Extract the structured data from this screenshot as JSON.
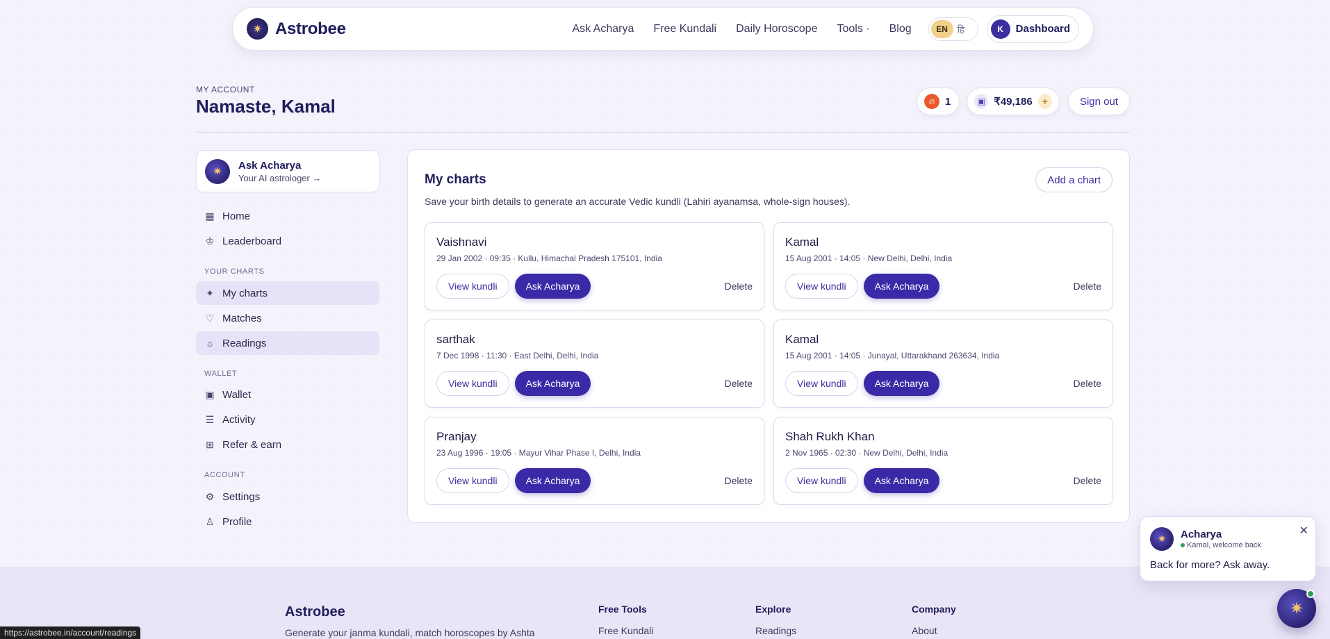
{
  "nav": {
    "brand": "Astrobee",
    "links": [
      "Ask Acharya",
      "Free Kundali",
      "Daily Horoscope",
      "Tools ·",
      "Blog"
    ],
    "lang_en": "EN",
    "lang_hi": "हि",
    "dashboard_initial": "K",
    "dashboard_label": "Dashboard"
  },
  "header": {
    "eyebrow": "MY ACCOUNT",
    "greeting": "Namaste, Kamal",
    "streak": "1",
    "wallet_balance": "₹49,186",
    "sign_out": "Sign out"
  },
  "sidebar": {
    "ask_title": "Ask Acharya",
    "ask_sub": "Your AI astrologer →",
    "home": "Home",
    "leaderboard": "Leaderboard",
    "section_charts": "YOUR CHARTS",
    "my_charts": "My charts",
    "matches": "Matches",
    "readings": "Readings",
    "section_wallet": "WALLET",
    "wallet": "Wallet",
    "activity": "Activity",
    "refer": "Refer & earn",
    "section_account": "ACCOUNT",
    "settings": "Settings",
    "profile": "Profile"
  },
  "main": {
    "title": "My charts",
    "description": "Save your birth details to generate an accurate Vedic kundli (Lahiri ayanamsa, whole-sign houses).",
    "add_label": "Add a chart",
    "view_label": "View kundli",
    "ask_label": "Ask Acharya",
    "delete_label": "Delete",
    "charts": [
      {
        "name": "Vaishnavi",
        "meta": "29 Jan 2002 · 09:35 · Kullu, Himachal Pradesh 175101, India"
      },
      {
        "name": "Kamal",
        "meta": "15 Aug 2001 · 14:05 · New Delhi, Delhi, India"
      },
      {
        "name": "sarthak",
        "meta": "7 Dec 1998 · 11:30 · East Delhi, Delhi, India"
      },
      {
        "name": "Kamal",
        "meta": "15 Aug 2001 · 14:05 · Junayal, Uttarakhand 263634, India"
      },
      {
        "name": "Pranjay",
        "meta": "23 Aug 1996 · 19:05 · Mayur Vihar Phase I, Delhi, India"
      },
      {
        "name": "Shah Rukh Khan",
        "meta": "2 Nov 1965 · 02:30 · New Delhi, Delhi, India"
      }
    ]
  },
  "footer": {
    "brand": "Astrobee",
    "tagline": "Generate your janma kundali, match horoscopes by Ashta",
    "col1_head": "Free Tools",
    "col1_link": "Free Kundali",
    "col2_head": "Explore",
    "col2_link": "Readings",
    "col3_head": "Company",
    "col3_link": "About"
  },
  "chat": {
    "name": "Acharya",
    "status": "Kamal, welcome back",
    "message": "Back for more? Ask away."
  },
  "statusbar": "https://astrobee.in/account/readings",
  "icons": {
    "logo": "sun-star-icon",
    "streak": "flame-icon",
    "wallet": "wallet-icon"
  }
}
